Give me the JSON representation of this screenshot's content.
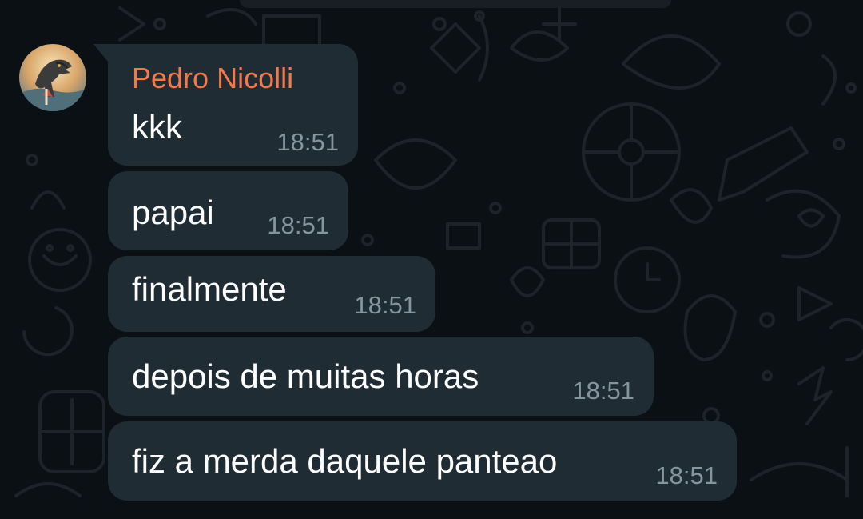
{
  "chat": {
    "sender": "Pedro Nicolli",
    "messages": [
      {
        "text": "kkk",
        "time": "18:51"
      },
      {
        "text": "papai",
        "time": "18:51"
      },
      {
        "text": "finalmente",
        "time": "18:51"
      },
      {
        "text": "depois de muitas horas",
        "time": "18:51"
      },
      {
        "text": "fiz a merda daquele panteao",
        "time": "18:51"
      }
    ]
  },
  "colors": {
    "background": "#0b1014",
    "bubble": "#1f2c34",
    "sender_name": "#f2794a",
    "message_text": "#ffffff",
    "timestamp": "#8696a0"
  },
  "icons": {
    "avatar": "dinosaur-avatar-icon",
    "wallpaper": "chat-doodle-wallpaper"
  }
}
